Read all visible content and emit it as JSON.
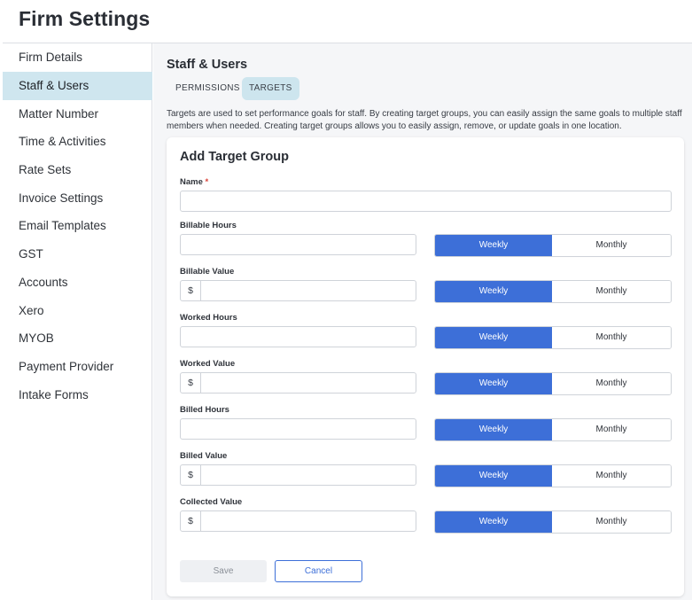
{
  "page": {
    "title": "Firm Settings"
  },
  "sidebar": {
    "items": [
      {
        "label": "Firm Details"
      },
      {
        "label": "Staff & Users"
      },
      {
        "label": "Matter Number"
      },
      {
        "label": "Time & Activities"
      },
      {
        "label": "Rate Sets"
      },
      {
        "label": "Invoice Settings"
      },
      {
        "label": "Email Templates"
      },
      {
        "label": "GST"
      },
      {
        "label": "Accounts"
      },
      {
        "label": "Xero"
      },
      {
        "label": "MYOB"
      },
      {
        "label": "Payment Provider"
      },
      {
        "label": "Intake Forms"
      }
    ],
    "active_index": 1
  },
  "main": {
    "title": "Staff & Users",
    "tabs": [
      {
        "label": "PERMISSIONS"
      },
      {
        "label": "TARGETS"
      }
    ],
    "active_tab": 1,
    "description": "Targets are used to set performance goals for staff. By creating target groups, you can easily assign the same goals to multiple staff members when needed. Creating target groups allows you to easily assign, remove, or update goals in one location."
  },
  "form": {
    "title": "Add Target Group",
    "name_label": "Name",
    "required_mark": "*",
    "name_value": "",
    "currency_symbol": "$",
    "fields": [
      {
        "label": "Billable Hours",
        "value": "",
        "period": "Weekly"
      },
      {
        "label": "Billable Value",
        "value": "",
        "period": "Weekly"
      },
      {
        "label": "Worked Hours",
        "value": "",
        "period": "Weekly"
      },
      {
        "label": "Worked Value",
        "value": "",
        "period": "Weekly"
      },
      {
        "label": "Billed Hours",
        "value": "",
        "period": "Weekly"
      },
      {
        "label": "Billed Value",
        "value": "",
        "period": "Weekly"
      },
      {
        "label": "Collected Value",
        "value": "",
        "period": "Weekly"
      }
    ],
    "period_options": {
      "weekly": "Weekly",
      "monthly": "Monthly"
    },
    "save_label": "Save",
    "cancel_label": "Cancel"
  },
  "colors": {
    "accent": "#3d6fd8",
    "active_nav": "#cfe6ef",
    "active_tab": "#cde5ee"
  }
}
